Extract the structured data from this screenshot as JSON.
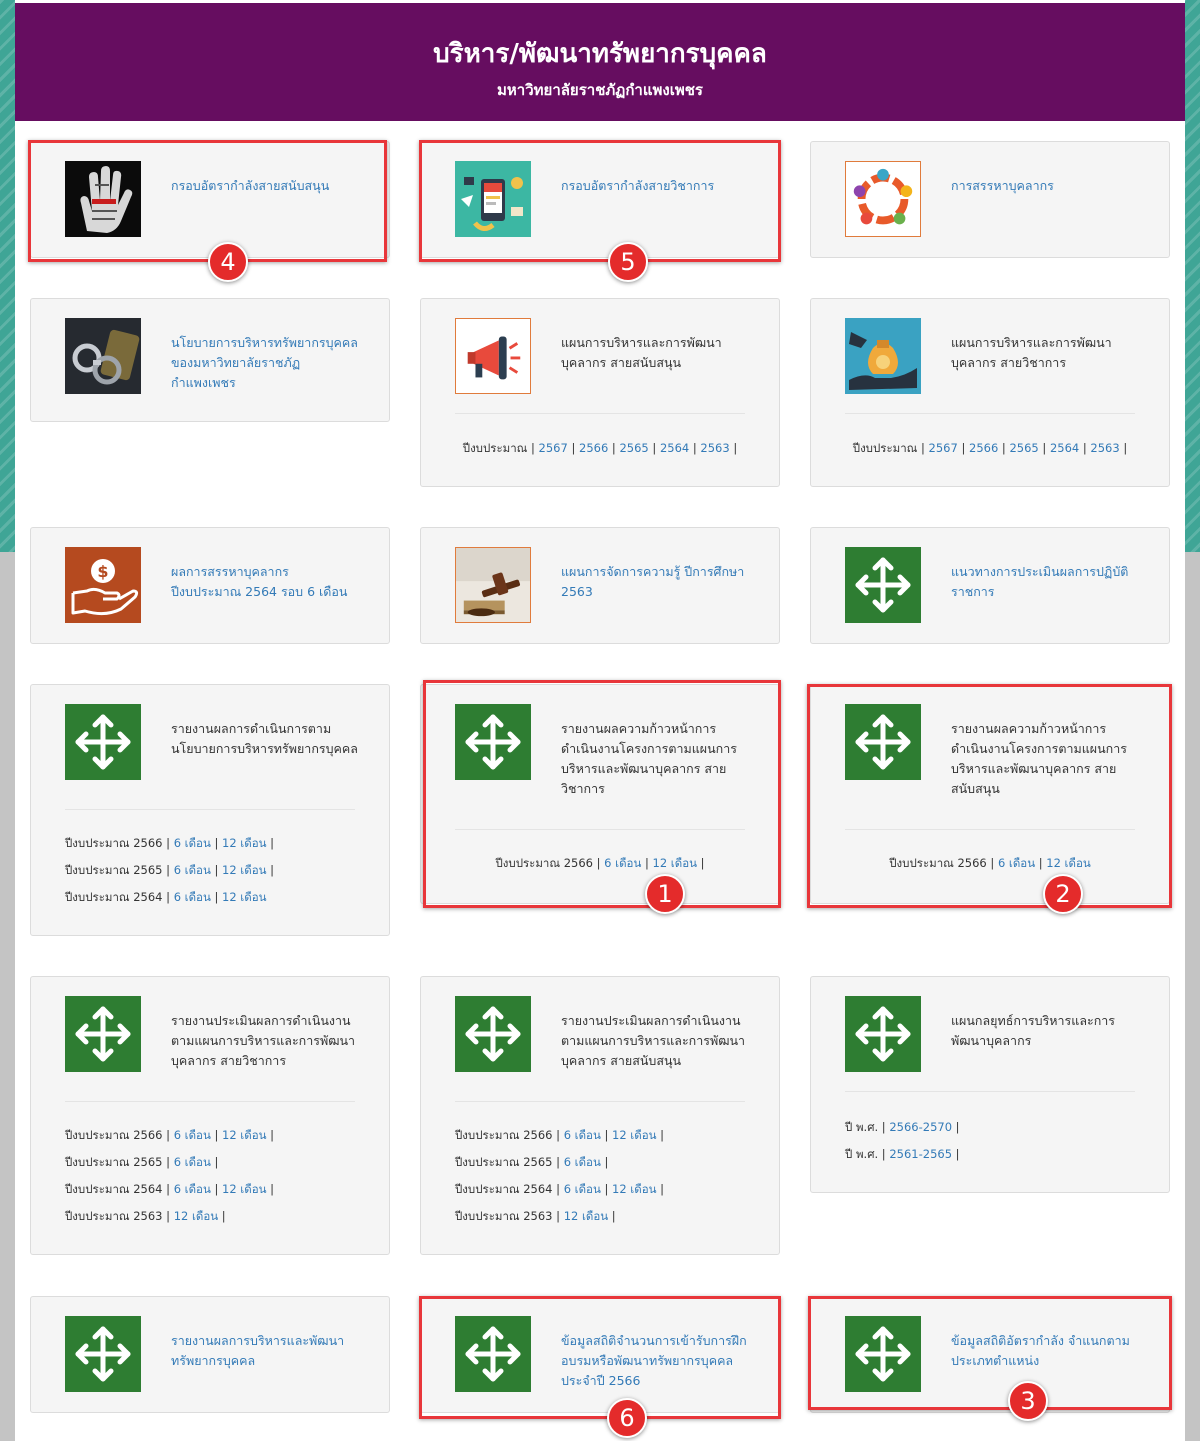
{
  "header": {
    "title": "บริหาร/พัฒนาทรัพยากรบุคคล",
    "subtitle": "มหาวิทยาลัยราชภัฏกำแพงเพชร"
  },
  "cards": [
    {
      "title": "กรอบอัตรากำลังสายสนับสนุน",
      "icon": "hand-icon"
    },
    {
      "title": "กรอบอัตรากำลังสายวิชาการ",
      "icon": "pr-media-icon"
    },
    {
      "title": "การสรรหาบุคลากร",
      "icon": "team-circle-icon"
    },
    {
      "title": "นโยบายการบริหารทรัพยากรบุคคลของมหาวิทยาลัยราชภัฏกำแพงเพชร",
      "icon": "handcuffs-money-icon"
    },
    {
      "title": "แผนการบริหารและการพัฒนาบุคลากร สายสนับสนุน",
      "icon": "megaphone-icon",
      "years_prefix": "ปีงบประมาณ",
      "years": [
        "2567",
        "2566",
        "2565",
        "2564",
        "2563"
      ]
    },
    {
      "title": "แผนการบริหารและการพัฒนาบุคลากร สายวิชาการ",
      "icon": "money-bag-icon",
      "years_prefix": "ปีงบประมาณ",
      "years": [
        "2567",
        "2566",
        "2565",
        "2564",
        "2563"
      ]
    },
    {
      "title": "ผลการสรรหาบุคลากร ปีงบประมาณ 2564 รอบ 6 เดือน",
      "icon": "hand-coin-icon"
    },
    {
      "title": "แผนการจัดการความรู้ ปีการศึกษา 2563",
      "icon": "gavel-book-icon"
    },
    {
      "title": "แนวทางการประเมินผลการปฏิบัติราชการ",
      "icon": "move-arrows-icon"
    },
    {
      "title": "รายงานผลการดำเนินการตามนโยบายการบริหารทรัพยากรบุคคล",
      "icon": "move-arrows-icon",
      "rows": [
        {
          "label": "ปีงบประมาณ 2566",
          "links": [
            "6 เดือน",
            "12 เดือน"
          ]
        },
        {
          "label": "ปีงบประมาณ 2565",
          "links": [
            "6 เดือน",
            "12 เดือน"
          ]
        },
        {
          "label": "ปีงบประมาณ 2564",
          "links": [
            "6 เดือน",
            "12 เดือน"
          ]
        }
      ]
    },
    {
      "title": "รายงานผลความก้าวหน้าการดำเนินงานโครงการตามแผนการบริหารและพัฒนาบุคลากร สายวิชาการ",
      "icon": "move-arrows-icon",
      "rows": [
        {
          "label": "ปีงบประมาณ 2566",
          "links": [
            "6 เดือน",
            "12 เดือน"
          ]
        }
      ]
    },
    {
      "title": "รายงานผลความก้าวหน้าการดำเนินงานโครงการตามแผนการบริหารและพัฒนาบุคลากร สายสนับสนุน",
      "icon": "move-arrows-icon",
      "rows": [
        {
          "label": "ปีงบประมาณ 2566",
          "links": [
            "6 เดือน",
            "12 เดือน"
          ]
        }
      ]
    },
    {
      "title": "รายงานประเมินผลการดำเนินงานตามแผนการบริหารและการพัฒนาบุคลากร สายวิชาการ",
      "icon": "move-arrows-icon",
      "rows": [
        {
          "label": "ปีงบประมาณ 2566",
          "links": [
            "6 เดือน",
            "12 เดือน"
          ]
        },
        {
          "label": "ปีงบประมาณ 2565",
          "links": [
            "6 เดือน"
          ]
        },
        {
          "label": "ปีงบประมาณ 2564",
          "links": [
            "6 เดือน",
            "12 เดือน"
          ]
        },
        {
          "label": "ปีงบประมาณ 2563",
          "links": [
            "12 เดือน"
          ]
        }
      ]
    },
    {
      "title": "รายงานประเมินผลการดำเนินงานตามแผนการบริหารและการพัฒนาบุคลากร สายสนับสนุน",
      "icon": "move-arrows-icon",
      "rows": [
        {
          "label": "ปีงบประมาณ 2566",
          "links": [
            "6 เดือน",
            "12 เดือน"
          ]
        },
        {
          "label": "ปีงบประมาณ 2565",
          "links": [
            "6 เดือน"
          ]
        },
        {
          "label": "ปีงบประมาณ 2564",
          "links": [
            "6 เดือน",
            "12 เดือน"
          ]
        },
        {
          "label": "ปีงบประมาณ 2563",
          "links": [
            "12 เดือน"
          ]
        }
      ]
    },
    {
      "title": "แผนกลยุทธ์การบริหารและการพัฒนาบุคลากร",
      "icon": "move-arrows-icon",
      "rows": [
        {
          "label": "ปี พ.ศ.",
          "links": [
            "2566-2570"
          ]
        },
        {
          "label": "ปี พ.ศ.",
          "links": [
            "2561-2565"
          ]
        }
      ]
    },
    {
      "title": "รายงานผลการบริหารและพัฒนาทรัพยากรบุคคล",
      "icon": "move-arrows-icon"
    },
    {
      "title": "ข้อมูลสถิติจำนวนการเข้ารับการฝึกอบรมหรือพัฒนาทรัพยากรบุคคล ประจำปี 2566",
      "icon": "move-arrows-icon"
    },
    {
      "title": "ข้อมูลสถิติอัตรากำลัง จำแนกตามประเภทตำแหน่ง",
      "icon": "move-arrows-icon"
    }
  ],
  "callouts": [
    "4",
    "5",
    "1",
    "2",
    "6",
    "3"
  ],
  "colors": {
    "header_bg": "#660d60",
    "link": "#337ab7",
    "callout_red": "#e42b2b",
    "icon_green": "#2e7d32"
  }
}
